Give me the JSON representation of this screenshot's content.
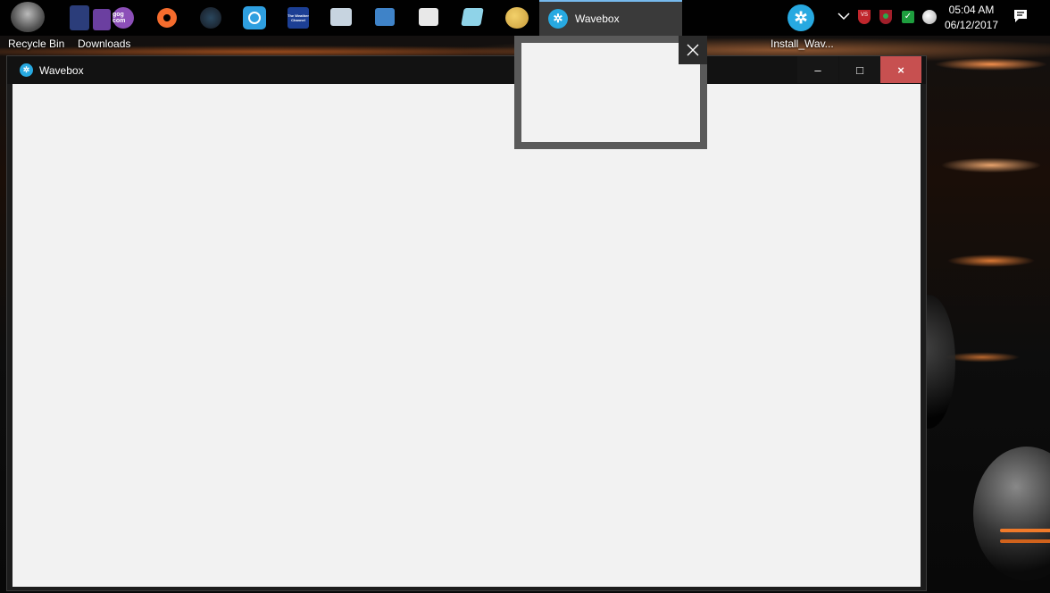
{
  "taskbar": {
    "pinned": [
      {
        "name": "recycle-bin-icon",
        "glyph": ""
      },
      {
        "name": "downloads-icon",
        "glyph": ""
      },
      {
        "name": "gog-icon",
        "glyph": "gog com"
      },
      {
        "name": "origin-icon",
        "glyph": ""
      },
      {
        "name": "steam-icon",
        "glyph": ""
      },
      {
        "name": "uplay-icon",
        "glyph": ""
      },
      {
        "name": "weather-channel-icon",
        "glyph": "The Weather Channel"
      },
      {
        "name": "monitor-app-icon",
        "glyph": ""
      },
      {
        "name": "control-panel-icon",
        "glyph": ""
      },
      {
        "name": "document-app-icon",
        "glyph": ""
      },
      {
        "name": "notes-app-icon",
        "glyph": ""
      },
      {
        "name": "paint-app-icon",
        "glyph": ""
      }
    ],
    "active_task": {
      "label": "Wavebox",
      "icon": "wavebox-icon"
    },
    "clock": {
      "time": "05:04 AM",
      "date": "06/12/2017"
    }
  },
  "desktop": {
    "icons": [
      {
        "label": "Recycle Bin"
      },
      {
        "label": "Downloads"
      },
      {
        "label": "Install_Wav..."
      }
    ]
  },
  "window": {
    "title": "Wavebox",
    "controls": {
      "minimize": "–",
      "maximize": "□",
      "close": "×"
    }
  },
  "colors": {
    "accent": "#27a9e1",
    "close_button": "#c75050",
    "active_task_border": "#76b9ed"
  }
}
